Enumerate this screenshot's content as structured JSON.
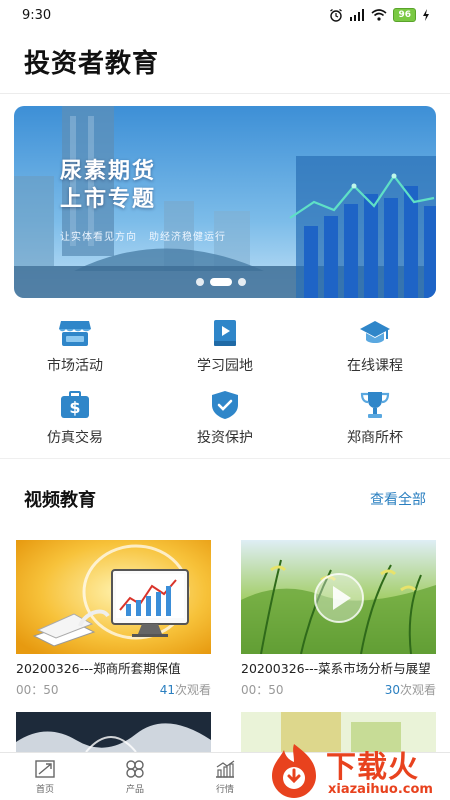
{
  "status_bar": {
    "time": "9:30",
    "battery": "96"
  },
  "header": {
    "title": "投资者教育"
  },
  "banner": {
    "title_line1": "尿素期货",
    "title_line2": "上市专题",
    "subtitle_left": "让实体看见方向",
    "subtitle_right": "助经济稳健运行",
    "slide_count": 3,
    "active_slide": 2
  },
  "quick_links": [
    {
      "label": "市场活动",
      "icon": "storefront-icon"
    },
    {
      "label": "学习园地",
      "icon": "play-book-icon"
    },
    {
      "label": "在线课程",
      "icon": "graduation-cap-icon"
    },
    {
      "label": "仿真交易",
      "icon": "dollar-briefcase-icon"
    },
    {
      "label": "投资保护",
      "icon": "shield-check-icon"
    },
    {
      "label": "郑商所杯",
      "icon": "trophy-icon"
    }
  ],
  "video_section": {
    "title": "视频教育",
    "see_all": "查看全部",
    "videos": [
      {
        "title": "20200326---郑商所套期保值",
        "duration": "00：50",
        "views": "41",
        "views_suffix": "次观看"
      },
      {
        "title": "20200326---菜系市场分析与展望",
        "duration": "00：50",
        "views": "30",
        "views_suffix": "次观看"
      }
    ]
  },
  "bottom_nav": [
    {
      "label": "首页",
      "icon": "home-icon"
    },
    {
      "label": "产品",
      "icon": "products-icon"
    },
    {
      "label": "行情",
      "icon": "market-chart-icon"
    }
  ],
  "watermark": {
    "text": "下载火",
    "url": "xiazaihuo.com"
  },
  "colors": {
    "accent": "#2a7fc0",
    "icon_blue": "#2f86c9",
    "watermark": "#e8421e"
  }
}
